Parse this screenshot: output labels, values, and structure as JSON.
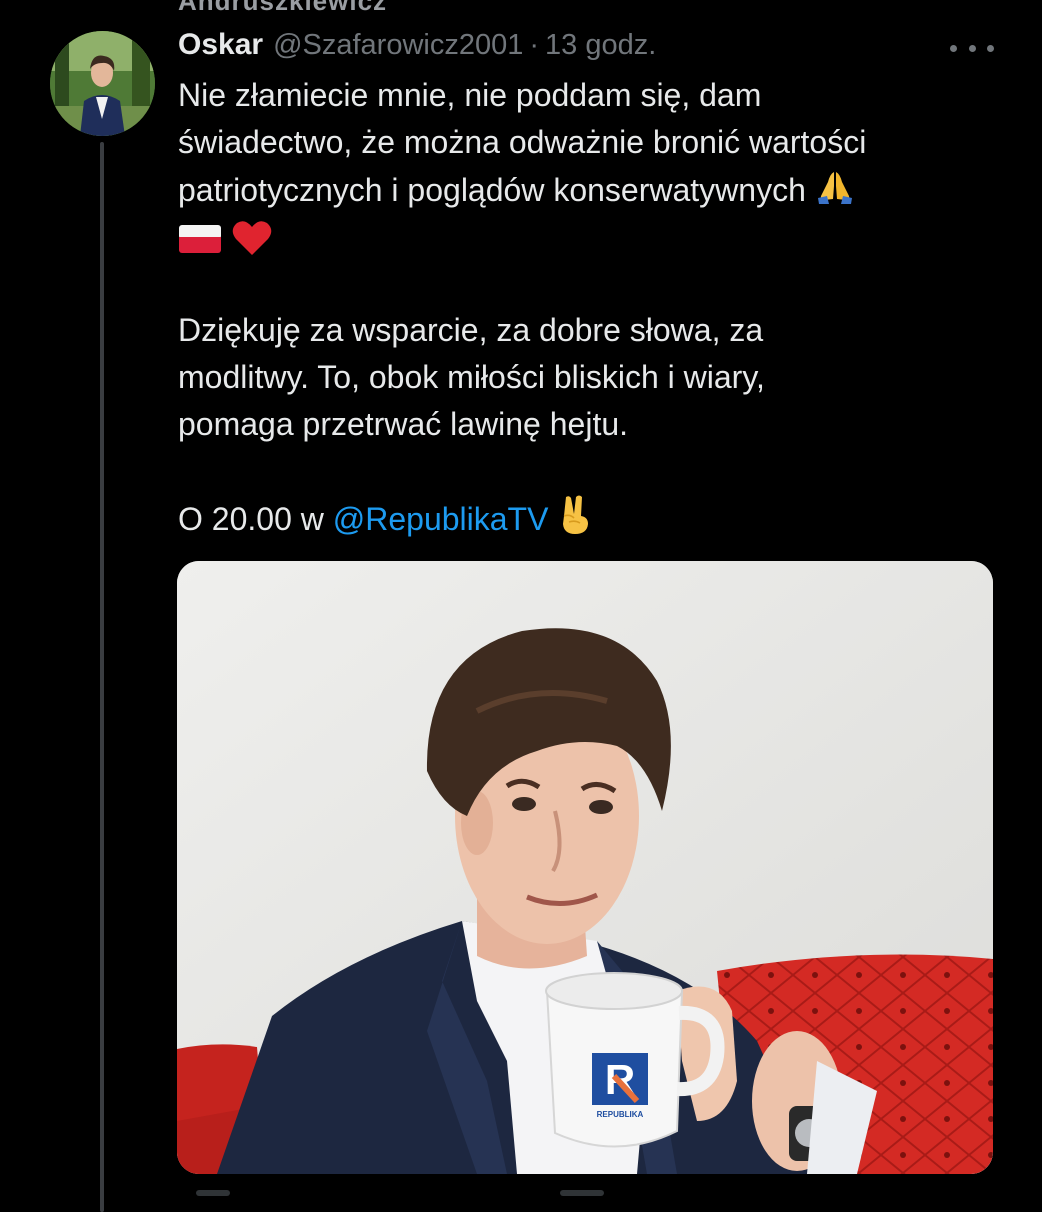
{
  "previous_tweet": {
    "author_name": "Andruszkiewicz"
  },
  "tweet": {
    "display_name": "Oskar",
    "handle": "@Szafarowicz2001",
    "separator": "·",
    "timestamp": "13 godz.",
    "more_icon": "more-horizontal-icon",
    "text": {
      "p1_line1": "Nie złamiecie mnie, nie poddam się, dam",
      "p1_line2": "świadectwo, że można odważnie bronić wartości",
      "p1_line3": "patriotycznych i poglądów konserwatywnych",
      "p2_line1": "Dziękuję za wsparcie, za dobre słowa, za",
      "p2_line2": "modlitwy. To, obok miłości bliskich i wiary,",
      "p2_line3": "pomaga przetrwać lawinę hejtu.",
      "p3_prefix": "O 20.00 w",
      "mention": "@RepublikaTV"
    },
    "emojis": [
      "folded-hands-emoji",
      "poland-flag-emoji",
      "red-heart-emoji",
      "victory-hand-emoji"
    ],
    "media": {
      "mug_logo_letter": "R",
      "mug_logo_text": "REPUBLIKA"
    }
  },
  "colors": {
    "background": "#000000",
    "text_primary": "#e7e9ea",
    "text_secondary": "#71767b",
    "mention": "#1d9bf0",
    "thread_line": "#3a3d41"
  }
}
